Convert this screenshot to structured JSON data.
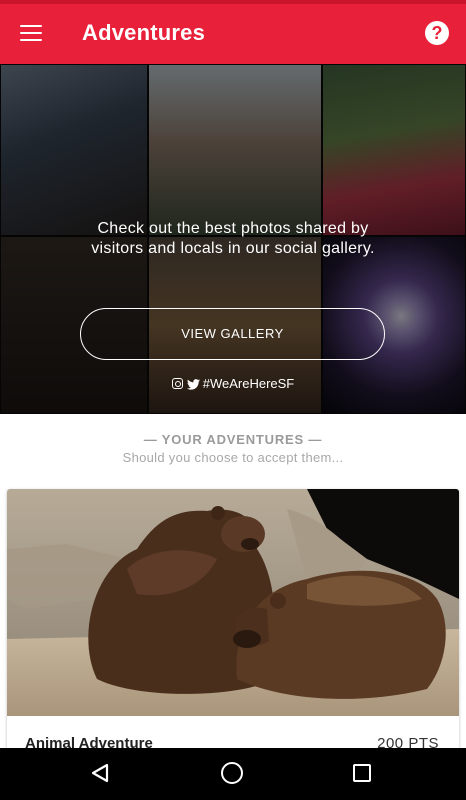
{
  "app": {
    "title": "Adventures",
    "help_glyph": "?"
  },
  "gallery": {
    "text_line1": "Check out the best photos shared by",
    "text_line2": "visitors and locals in our social gallery.",
    "button_label": "VIEW GALLERY",
    "hashtag": "#WeAreHereSF"
  },
  "adventures": {
    "heading": "— YOUR ADVENTURES —",
    "subheading": "Should you choose to accept them..."
  },
  "cards": [
    {
      "title": "Animal Adventure",
      "points": "200 PTS",
      "image": "bears-photo"
    }
  ],
  "colors": {
    "appbar": "#e8203a",
    "statusbar": "#c9142b"
  },
  "icons": {
    "menu": "menu-icon",
    "help": "help-icon",
    "instagram": "instagram-icon",
    "twitter": "twitter-icon",
    "back": "back-icon",
    "home": "home-icon",
    "recent": "recent-apps-icon"
  }
}
